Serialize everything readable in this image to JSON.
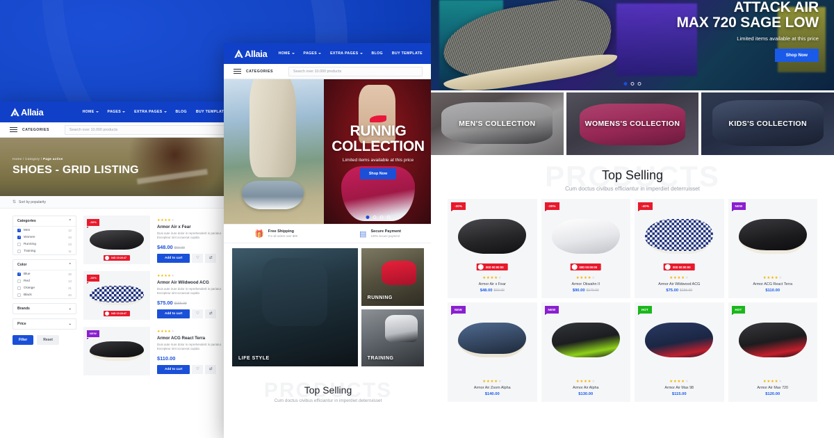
{
  "brand": {
    "name": "Allaia"
  },
  "colors": {
    "background_blue": "#0a3bb8",
    "accent_blue": "#1a4fd8",
    "sale_red": "#e8192c",
    "new_purple": "#8a1fd0",
    "hot_green": "#1bb71b",
    "star_gold": "#f4b400"
  },
  "nav": {
    "links": [
      {
        "label": "HOME",
        "caret": true
      },
      {
        "label": "PAGES",
        "caret": true
      },
      {
        "label": "EXTRA PAGES",
        "caret": true
      },
      {
        "label": "BLOG",
        "caret": false
      },
      {
        "label": "BUY TEMPLATE",
        "caret": false
      }
    ]
  },
  "search": {
    "categories_label": "CATEGORIES",
    "placeholder": "Search over 10.000 products",
    "icon": "search-icon"
  },
  "left_window": {
    "breadcrumb": {
      "home": "Home",
      "sep": "/",
      "category": "Category",
      "active": "Page active"
    },
    "page_title": "SHOES - GRID LISTING",
    "sort_label": "Sort by popularity",
    "sort_icon": "sort-arrow-icon",
    "filters": [
      {
        "title": "Categories",
        "collapsed": false,
        "chevron": "chevron-up-icon",
        "options": [
          {
            "label": "Men",
            "count": "12",
            "checked": true
          },
          {
            "label": "Women",
            "count": "34",
            "checked": true
          },
          {
            "label": "Running",
            "count": "23",
            "checked": false
          },
          {
            "label": "Training",
            "count": "11",
            "checked": false
          }
        ]
      },
      {
        "title": "Color",
        "collapsed": false,
        "chevron": "chevron-up-icon",
        "options": [
          {
            "label": "Blue",
            "count": "30",
            "checked": true
          },
          {
            "label": "Red",
            "count": "13",
            "checked": false
          },
          {
            "label": "Orange",
            "count": "21",
            "checked": false
          },
          {
            "label": "Black",
            "count": "40",
            "checked": false
          }
        ]
      },
      {
        "title": "Brands",
        "collapsed": true,
        "chevron": "chevron-down-icon",
        "options": []
      },
      {
        "title": "Price",
        "collapsed": true,
        "chevron": "chevron-down-icon",
        "options": []
      }
    ],
    "filter_button": "Filter",
    "reset_button": "Reset",
    "product_desc": "Duis aute irure dolor in reprehenderit in pariatur. Excepteur sint occaecat cupida",
    "add_to_cart": "Add to cart",
    "wishlist_icon": "heart-icon",
    "compare_icon": "compare-icon",
    "products": [
      {
        "badge": "-30%",
        "badge_type": "sale",
        "timer": "04D 15:28:47",
        "timer_icon": "stopwatch-icon",
        "name": "Armor Air x Fear",
        "price": "$48.00",
        "old_price": "$60.00",
        "rating": 4,
        "image": "black-running-shoe"
      },
      {
        "badge": "-30%",
        "badge_type": "sale",
        "timer": "04D 15:28:47",
        "timer_icon": "stopwatch-icon",
        "name": "Armor Air Wildwood ACG",
        "price": "$75.00",
        "old_price": "$155.00",
        "rating": 4,
        "image": "checkered-slipon-shoe"
      },
      {
        "badge": "NEW",
        "badge_type": "new",
        "timer": "",
        "timer_icon": "",
        "name": "Armor ACG React Terra",
        "price": "$110.00",
        "old_price": "",
        "rating": 4,
        "image": "black-high-top-sneaker"
      }
    ]
  },
  "mid_window": {
    "hero": {
      "title_line1": "RUNNIG",
      "title_line2": "COLLECTION",
      "subtitle": "Limited items available at this price",
      "button": "Shop Now",
      "slider_dots": 4,
      "active_dot": 0
    },
    "features": [
      {
        "icon": "gift-icon",
        "title": "Free Shipping",
        "sub": "For all orders over $99"
      },
      {
        "icon": "card-icon",
        "title": "Secure Payment",
        "sub": "100% secure payment"
      }
    ],
    "tiles": [
      {
        "label": "LIFE STYLE",
        "size": "big"
      },
      {
        "label": "RUNNING",
        "size": "small"
      },
      {
        "label": "TRAINING",
        "size": "small"
      }
    ],
    "section": {
      "watermark": "PRODUCTS",
      "title": "Top Selling",
      "subtitle": "Cum doctus civibus efficiantur in imperdiet deterruisset"
    }
  },
  "right_window": {
    "hero": {
      "title_line1": "ATTACK AIR",
      "title_line2": "MAX 720 SAGE LOW",
      "subtitle": "Limited items available at this price",
      "button": "Shop Now",
      "slider_dots": 3,
      "active_dot": 0
    },
    "collections": [
      {
        "label": "MEN'S COLLECTION",
        "theme": "men"
      },
      {
        "label": "WOMENS'S COLLECTION",
        "theme": "women"
      },
      {
        "label": "KIDS'S COLLECTION",
        "theme": "kids"
      }
    ],
    "section": {
      "watermark": "PRODUCTS",
      "title": "Top Selling",
      "subtitle": "Cum doctus civibus efficiantur in imperdiet deterruisset"
    },
    "products": [
      {
        "badge": "-30%",
        "badge_type": "sale",
        "timer": "00D 00:00:00",
        "name": "Armor Air x Fear",
        "price": "$48.00",
        "old_price": "$60.00",
        "rating": 4,
        "image": "black-running-shoe"
      },
      {
        "badge": "-30%",
        "badge_type": "sale",
        "timer": "00D 00:00:00",
        "name": "Armor Okwahn II",
        "price": "$90.00",
        "old_price": "$170.00",
        "rating": 4,
        "image": "white-grey-sneaker"
      },
      {
        "badge": "-40%",
        "badge_type": "sale",
        "timer": "00D 00:00:00",
        "name": "Armor Air Wildwood ACG",
        "price": "$75.00",
        "old_price": "$155.00",
        "rating": 4,
        "image": "checkered-slipon-shoe"
      },
      {
        "badge": "NEW",
        "badge_type": "new",
        "timer": "",
        "name": "Armor ACG React Terra",
        "price": "$110.00",
        "old_price": "",
        "rating": 4,
        "image": "black-high-top-sneaker"
      },
      {
        "badge": "NEW",
        "badge_type": "new",
        "timer": "",
        "name": "Armor Air Zoom Alpha",
        "price": "$140.00",
        "old_price": "",
        "rating": 4,
        "image": "denim-blue-sneaker"
      },
      {
        "badge": "NEW",
        "badge_type": "new",
        "timer": "",
        "name": "Armor Air Alpha",
        "price": "$130.00",
        "old_price": "",
        "rating": 4,
        "image": "black-volt-high-top"
      },
      {
        "badge": "HOT",
        "badge_type": "hot",
        "timer": "",
        "name": "Armor Air Max 98",
        "price": "$115.00",
        "old_price": "",
        "rating": 4,
        "image": "navy-red-sneaker"
      },
      {
        "badge": "HOT",
        "badge_type": "hot",
        "timer": "",
        "name": "Armor Air Max 720",
        "price": "$120.00",
        "old_price": "",
        "rating": 4,
        "image": "black-red-sneaker"
      }
    ]
  }
}
